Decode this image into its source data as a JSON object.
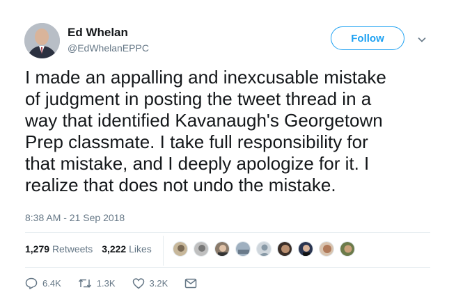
{
  "user": {
    "name": "Ed Whelan",
    "handle": "@EdWhelanEPPC",
    "follow_label": "Follow"
  },
  "tweet": {
    "lines": [
      "I made an appalling and inexcusable mistake",
      "of judgment in posting the tweet thread in a",
      "way that identified Kavanaugh's Georgetown",
      "Prep classmate. I take full responsibility for",
      "that mistake, and I deeply apologize for it. I",
      "realize that does not undo the mistake."
    ],
    "timestamp": "8:38 AM - 21 Sep 2018"
  },
  "stats": {
    "retweets_count": "1,279",
    "retweets_label": "Retweets",
    "likes_count": "3,222",
    "likes_label": "Likes"
  },
  "actions": {
    "replies": "6.4K",
    "retweets": "1.3K",
    "likes": "3.2K"
  },
  "colors": {
    "accent": "#1da1f2",
    "secondary_text": "#657786",
    "primary_text": "#14171a"
  }
}
